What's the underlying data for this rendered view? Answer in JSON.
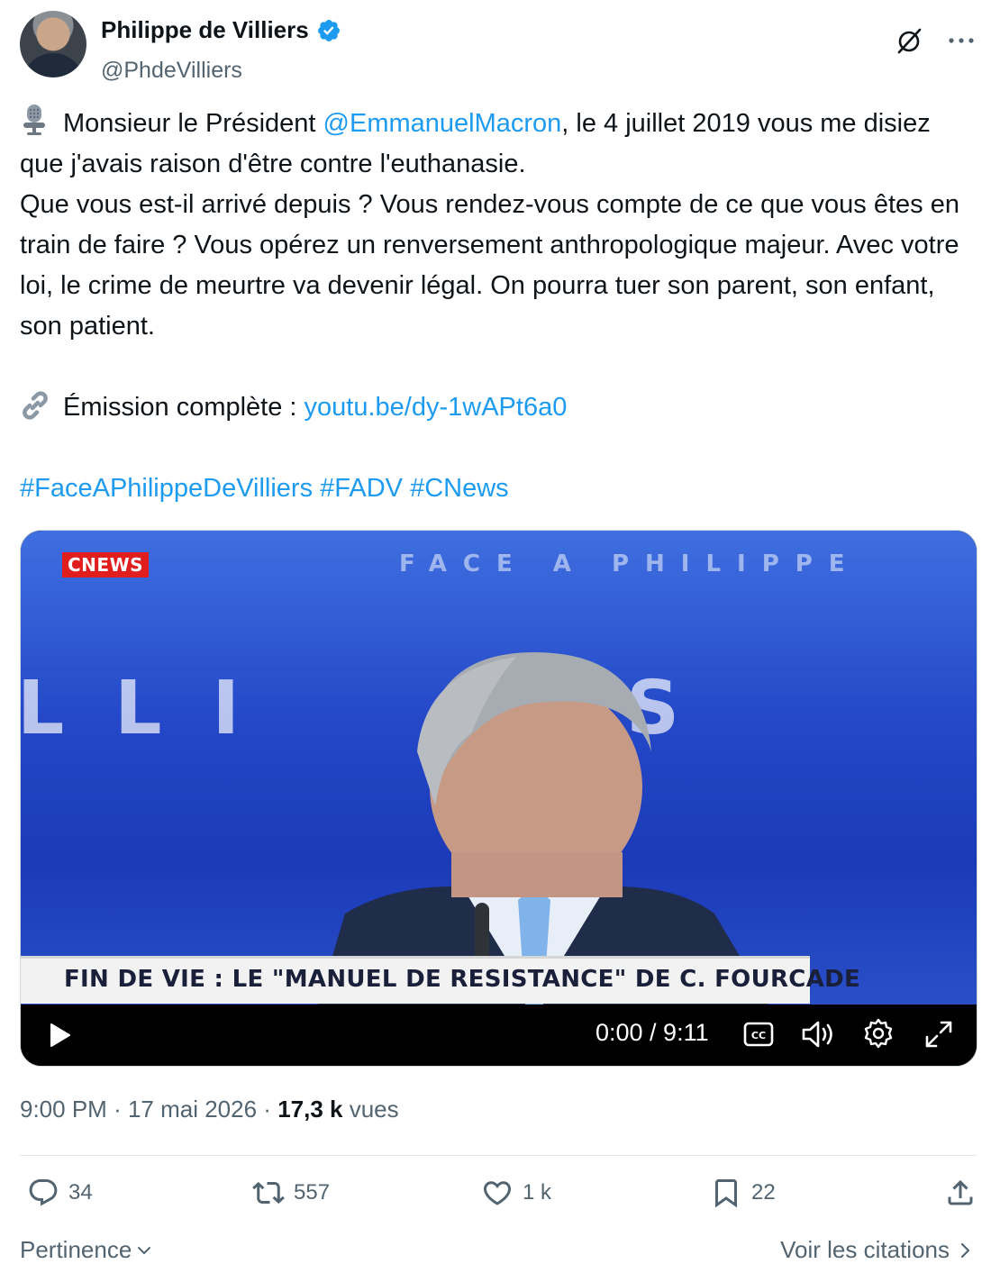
{
  "author": {
    "name": "Philippe de Villiers",
    "handle": "@PhdeVilliers"
  },
  "tweet": {
    "line1_pre": "Monsieur le Président ",
    "mention": "@EmmanuelMacron",
    "line1_post": ", le 4 juillet 2019 vous me disiez que j'avais raison d'être contre l'euthanasie.",
    "paragraph2": "Que vous est-il arrivé depuis ? Vous rendez-vous compte de ce que vous êtes en train de faire ? Vous opérez un renversement anthropologique majeur. Avec votre loi, le crime de meurtre va devenir légal. On pourra tuer son parent, son enfant, son patient.",
    "emission_label": "Émission complète : ",
    "emission_link": "youtu.be/dy-1wAPt6a0",
    "hashtags": [
      "#FaceAPhilippeDeVilliers",
      "#FADV",
      "#CNews"
    ]
  },
  "video": {
    "channel_badge": "CNEWS",
    "banner": "FIN DE VIE : LE \"MANUEL DE RESISTANCE\" DE C. FOURCADE",
    "time": "0:00 / 9:11",
    "icons": [
      "play-icon",
      "cc-icon",
      "volume-icon",
      "gear-icon",
      "fullscreen-icon"
    ]
  },
  "meta": {
    "time": "9:00 PM",
    "date": "17 mai 2026",
    "views_count": "17,3 k",
    "views_label": "vues"
  },
  "actions": {
    "replies": "34",
    "reposts": "557",
    "likes": "1 k",
    "bookmarks": "22"
  },
  "footer": {
    "sort_label": "Pertinence",
    "quotes_label": "Voir les citations"
  },
  "colors": {
    "link": "#1d9bf0",
    "muted": "#536471",
    "verified": "#1d9bf0"
  }
}
